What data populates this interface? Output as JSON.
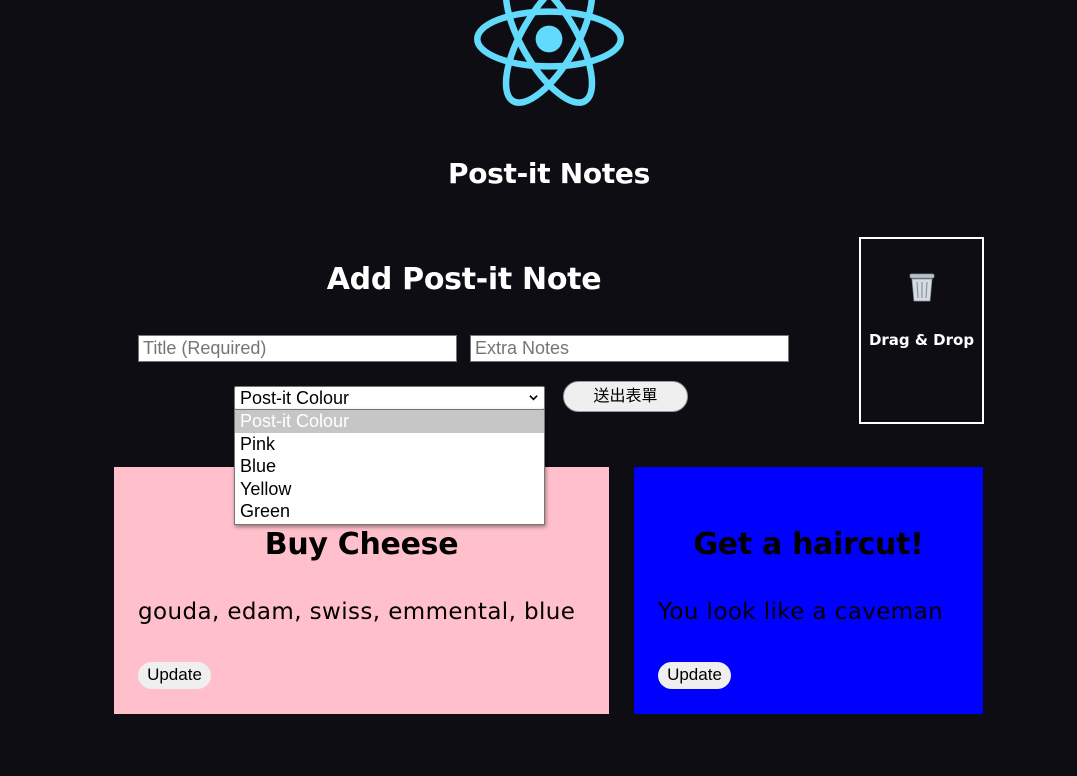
{
  "app": {
    "title": "Post-it Notes"
  },
  "form": {
    "heading": "Add Post-it Note",
    "title_input": {
      "placeholder": "Title (Required)",
      "value": ""
    },
    "notes_input": {
      "placeholder": "Extra Notes",
      "value": ""
    },
    "colour_select": {
      "selected": "Post-it Colour",
      "options": [
        "Post-it Colour",
        "Pink",
        "Blue",
        "Yellow",
        "Green"
      ]
    },
    "submit_label": "送出表單"
  },
  "trash": {
    "label": "Drag & Drop",
    "icon": "wastebasket-icon"
  },
  "notes": [
    {
      "title": "Buy Cheese",
      "body": "gouda, edam, swiss, emmental, blue",
      "color": "#ffc0cb",
      "update_label": "Update"
    },
    {
      "title": "Get a haircut!",
      "body": "You look like a caveman",
      "color": "#0000ff",
      "update_label": "Update"
    }
  ],
  "colors": {
    "background": "#0d0d13",
    "logo": "#61dafb"
  }
}
